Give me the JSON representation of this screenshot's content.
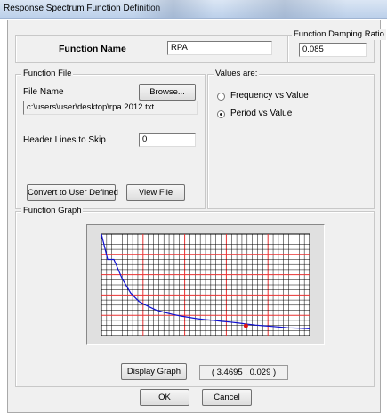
{
  "window": {
    "title": "Response Spectrum  Function Definition"
  },
  "name_section": {
    "label": "Function Name",
    "value": "RPA"
  },
  "damping": {
    "legend": "Function Damping Ratio",
    "value": "0.085"
  },
  "function_file": {
    "legend": "Function File",
    "file_name_label": "File Name",
    "browse_label": "Browse...",
    "file_path": "c:\\users\\user\\desktop\\rpa 2012.txt",
    "header_lines_label": "Header Lines to Skip",
    "header_lines_value": "0",
    "convert_label": "Convert to User Defined",
    "view_file_label": "View File"
  },
  "values_are": {
    "legend": "Values are:",
    "options": [
      {
        "label": "Frequency vs Value",
        "selected": false
      },
      {
        "label": "Period vs Value",
        "selected": true
      }
    ]
  },
  "graph": {
    "legend": "Function Graph",
    "display_graph_label": "Display Graph",
    "cursor_readout": "( 3.4695 ,  0.029 )",
    "colors": {
      "curve": "#1010d0",
      "marker": "#e01010",
      "major_grid": "#e83030",
      "minor_grid": "#000000",
      "background": "#ffffff"
    }
  },
  "chart_data": {
    "type": "line",
    "x": [
      0.0,
      0.15,
      0.3,
      0.5,
      0.7,
      0.9,
      1.1,
      1.3,
      1.5,
      1.7,
      1.9,
      2.1,
      2.3,
      2.5,
      2.7,
      2.9,
      3.1,
      3.3,
      3.5,
      3.7,
      3.9,
      4.1,
      4.3,
      4.5,
      4.7,
      4.9,
      5.0
    ],
    "y": [
      0.3,
      0.225,
      0.225,
      0.168,
      0.126,
      0.101,
      0.088,
      0.076,
      0.069,
      0.063,
      0.058,
      0.054,
      0.05,
      0.047,
      0.045,
      0.042,
      0.04,
      0.037,
      0.034,
      0.031,
      0.029,
      0.027,
      0.025,
      0.023,
      0.022,
      0.021,
      0.02
    ],
    "xlim": [
      0,
      5.0
    ],
    "ylim": [
      0,
      0.3
    ],
    "grid": true,
    "highlight_point": {
      "x": 3.4695,
      "y": 0.029
    }
  },
  "actions": {
    "ok_label": "OK",
    "cancel_label": "Cancel"
  }
}
